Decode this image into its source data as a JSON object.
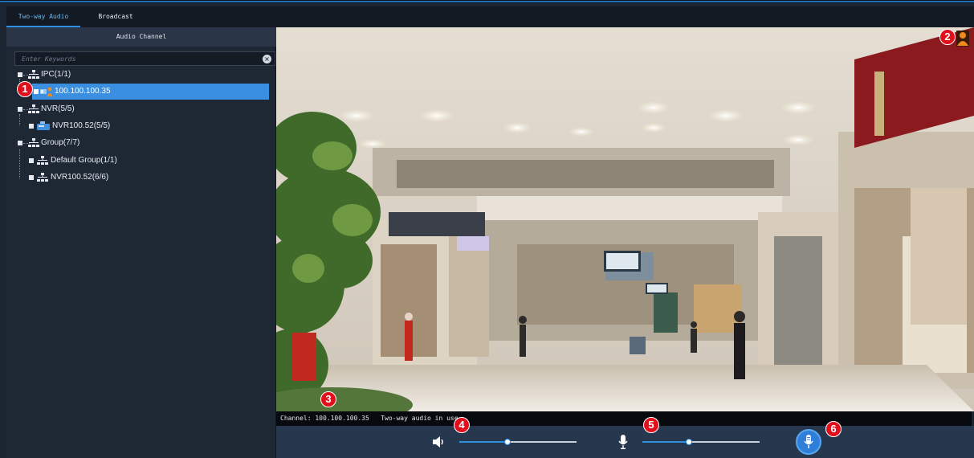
{
  "tabs": {
    "two_way_audio": "Two-way Audio",
    "broadcast": "Broadcast"
  },
  "sidebar": {
    "title": "Audio Channel",
    "search_placeholder": "Enter Keywords",
    "tree": {
      "ipc": "IPC(1/1)",
      "ipc_device": "100.100.100.35",
      "nvr": "NVR(5/5)",
      "nvr_device": "NVR100.52(5/5)",
      "group": "Group(7/7)",
      "default_group": "Default Group(1/1)",
      "group_nvr": "NVR100.52(6/6)"
    }
  },
  "status": {
    "channel_text": "Channel: 100.100.100.35   Two-way audio in use"
  },
  "controls": {
    "speaker_level": 0.41,
    "mic_level": 0.4
  },
  "callouts": [
    "1",
    "2",
    "3",
    "4",
    "5",
    "6"
  ],
  "icons": {
    "tree_group": "network-tree-icon",
    "ipc_device": "camera-speaking-icon",
    "nvr_device": "nvr-icon",
    "stop_audio": "speaking-person-icon",
    "speaker": "speaker-icon",
    "microphone": "microphone-icon",
    "talk": "microphone-talk-icon"
  },
  "colors": {
    "accent": "#2f8fe0",
    "selected_row": "#3a8fe0",
    "callout": "#e10f1c",
    "speaking_orange": "#f28a1b"
  }
}
